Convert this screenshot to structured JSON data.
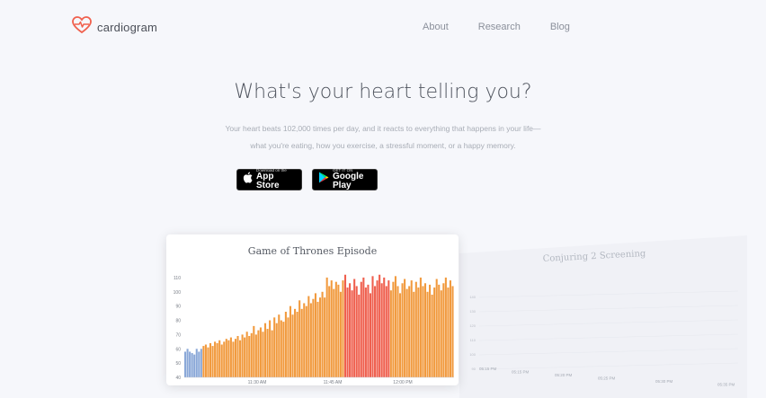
{
  "brand": {
    "name": "cardiogram",
    "accent": "#f0604d",
    "icon": "heart-pulse-icon"
  },
  "nav": {
    "items": [
      "About",
      "Research",
      "Blog"
    ]
  },
  "hero": {
    "title": "What's your heart telling you?",
    "subtitle_line1": "Your heart beats 102,000 times per day, and it reacts to everything that happens in your life—",
    "subtitle_line2": "what you're eating, how you exercise, a stressful moment, or a happy memory."
  },
  "badges": {
    "app_store": {
      "small": "Download on the",
      "big": "App Store",
      "icon": "apple-icon"
    },
    "google_play": {
      "small": "GET IT ON",
      "big": "Google Play",
      "icon": "play-triangle-icon"
    }
  },
  "chart_data": [
    {
      "type": "bar",
      "title": "Game of Thrones Episode",
      "ylim": [
        40,
        115
      ],
      "y_ticks": [
        40,
        50,
        60,
        70,
        80,
        90,
        100,
        110
      ],
      "x_tick_labels": [
        "11:30 AM",
        "11:45 AM",
        "12:00 PM"
      ],
      "colors": {
        "low": "#8aa8d8",
        "mid": "#f19a3e",
        "high": "#ef5f4e"
      },
      "values": [
        58,
        60,
        58,
        57,
        56,
        60,
        58,
        60,
        62,
        63,
        61,
        64,
        62,
        65,
        64,
        66,
        63,
        65,
        67,
        66,
        68,
        65,
        67,
        69,
        66,
        70,
        68,
        72,
        69,
        71,
        76,
        70,
        73,
        75,
        72,
        78,
        74,
        80,
        73,
        82,
        78,
        84,
        80,
        79,
        86,
        82,
        90,
        84,
        88,
        86,
        94,
        88,
        92,
        90,
        97,
        92,
        95,
        99,
        93,
        96,
        100,
        96,
        110,
        104,
        108,
        102,
        107,
        105,
        100,
        108,
        112,
        103,
        106,
        101,
        109,
        104,
        98,
        107,
        110,
        103,
        105,
        99,
        111,
        104,
        108,
        112,
        106,
        110,
        104,
        108,
        101,
        107,
        111,
        104,
        99,
        106,
        109,
        102,
        104,
        108,
        100,
        107,
        103,
        110,
        104,
        106,
        100,
        105,
        98,
        103,
        109,
        105,
        101,
        106,
        110,
        103,
        108,
        104
      ],
      "segments": [
        {
          "category": "low",
          "count": 8
        },
        {
          "category": "mid",
          "count": 62
        },
        {
          "category": "high",
          "count": 20
        },
        {
          "category": "mid",
          "count": 28
        }
      ]
    },
    {
      "type": "line",
      "title": "Conjuring 2 Screening",
      "y_ticks": [
        90,
        100,
        110,
        120,
        130,
        140
      ],
      "x_tick_labels": [
        "05:15 PM",
        "05:15 PM",
        "05:20 PM",
        "05:25 PM",
        "05:30 PM",
        "05:35 PM"
      ]
    }
  ]
}
